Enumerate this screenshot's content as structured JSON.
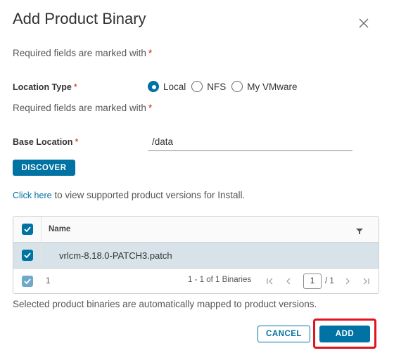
{
  "dialog": {
    "title": "Add Product Binary"
  },
  "required_note": {
    "text": "Required fields are marked with",
    "star": "*"
  },
  "location_type": {
    "label": "Location Type",
    "star": "*",
    "options": [
      {
        "label": "Local",
        "selected": true
      },
      {
        "label": "NFS",
        "selected": false
      },
      {
        "label": "My VMware",
        "selected": false
      }
    ]
  },
  "base_location": {
    "label": "Base Location",
    "star": "*",
    "value": "/data"
  },
  "buttons": {
    "discover": "DISCOVER",
    "cancel": "CANCEL",
    "add": "ADD"
  },
  "help": {
    "link": "Click here",
    "text": " to view supported product versions for Install."
  },
  "grid": {
    "column_name": "Name",
    "rows": [
      {
        "name": "vrlcm-8.18.0-PATCH3.patch",
        "selected": true
      }
    ],
    "footer": {
      "selected_count": "1",
      "range": "1 - 1 of 1 Binaries",
      "page": "1",
      "total_pages": "/ 1"
    }
  },
  "mapping_note": "Selected product binaries are automatically mapped to product versions.",
  "colors": {
    "primary": "#0072a3",
    "required": "#c92100",
    "highlight": "#e0141e",
    "selected_row": "#d8e3e9"
  },
  "icons": {
    "close": "close-icon",
    "filter": "filter-icon",
    "checkmark": "check-icon",
    "first_page": "first-page-icon",
    "prev_page": "prev-page-icon",
    "next_page": "next-page-icon",
    "last_page": "last-page-icon"
  }
}
